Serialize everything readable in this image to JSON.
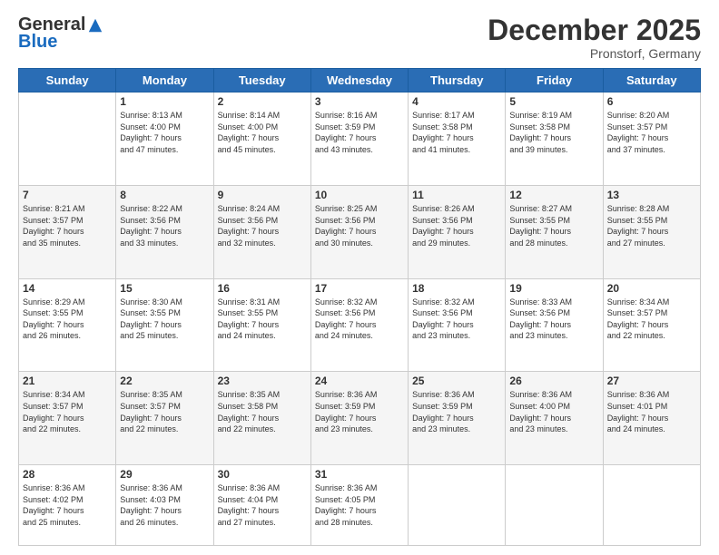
{
  "header": {
    "logo": {
      "general": "General",
      "blue": "Blue"
    },
    "title": "December 2025",
    "location": "Pronstorf, Germany"
  },
  "weekdays": [
    "Sunday",
    "Monday",
    "Tuesday",
    "Wednesday",
    "Thursday",
    "Friday",
    "Saturday"
  ],
  "weeks": [
    [
      {
        "day": "",
        "info": ""
      },
      {
        "day": "1",
        "info": "Sunrise: 8:13 AM\nSunset: 4:00 PM\nDaylight: 7 hours\nand 47 minutes."
      },
      {
        "day": "2",
        "info": "Sunrise: 8:14 AM\nSunset: 4:00 PM\nDaylight: 7 hours\nand 45 minutes."
      },
      {
        "day": "3",
        "info": "Sunrise: 8:16 AM\nSunset: 3:59 PM\nDaylight: 7 hours\nand 43 minutes."
      },
      {
        "day": "4",
        "info": "Sunrise: 8:17 AM\nSunset: 3:58 PM\nDaylight: 7 hours\nand 41 minutes."
      },
      {
        "day": "5",
        "info": "Sunrise: 8:19 AM\nSunset: 3:58 PM\nDaylight: 7 hours\nand 39 minutes."
      },
      {
        "day": "6",
        "info": "Sunrise: 8:20 AM\nSunset: 3:57 PM\nDaylight: 7 hours\nand 37 minutes."
      }
    ],
    [
      {
        "day": "7",
        "info": "Sunrise: 8:21 AM\nSunset: 3:57 PM\nDaylight: 7 hours\nand 35 minutes."
      },
      {
        "day": "8",
        "info": "Sunrise: 8:22 AM\nSunset: 3:56 PM\nDaylight: 7 hours\nand 33 minutes."
      },
      {
        "day": "9",
        "info": "Sunrise: 8:24 AM\nSunset: 3:56 PM\nDaylight: 7 hours\nand 32 minutes."
      },
      {
        "day": "10",
        "info": "Sunrise: 8:25 AM\nSunset: 3:56 PM\nDaylight: 7 hours\nand 30 minutes."
      },
      {
        "day": "11",
        "info": "Sunrise: 8:26 AM\nSunset: 3:56 PM\nDaylight: 7 hours\nand 29 minutes."
      },
      {
        "day": "12",
        "info": "Sunrise: 8:27 AM\nSunset: 3:55 PM\nDaylight: 7 hours\nand 28 minutes."
      },
      {
        "day": "13",
        "info": "Sunrise: 8:28 AM\nSunset: 3:55 PM\nDaylight: 7 hours\nand 27 minutes."
      }
    ],
    [
      {
        "day": "14",
        "info": "Sunrise: 8:29 AM\nSunset: 3:55 PM\nDaylight: 7 hours\nand 26 minutes."
      },
      {
        "day": "15",
        "info": "Sunrise: 8:30 AM\nSunset: 3:55 PM\nDaylight: 7 hours\nand 25 minutes."
      },
      {
        "day": "16",
        "info": "Sunrise: 8:31 AM\nSunset: 3:55 PM\nDaylight: 7 hours\nand 24 minutes."
      },
      {
        "day": "17",
        "info": "Sunrise: 8:32 AM\nSunset: 3:56 PM\nDaylight: 7 hours\nand 24 minutes."
      },
      {
        "day": "18",
        "info": "Sunrise: 8:32 AM\nSunset: 3:56 PM\nDaylight: 7 hours\nand 23 minutes."
      },
      {
        "day": "19",
        "info": "Sunrise: 8:33 AM\nSunset: 3:56 PM\nDaylight: 7 hours\nand 23 minutes."
      },
      {
        "day": "20",
        "info": "Sunrise: 8:34 AM\nSunset: 3:57 PM\nDaylight: 7 hours\nand 22 minutes."
      }
    ],
    [
      {
        "day": "21",
        "info": "Sunrise: 8:34 AM\nSunset: 3:57 PM\nDaylight: 7 hours\nand 22 minutes."
      },
      {
        "day": "22",
        "info": "Sunrise: 8:35 AM\nSunset: 3:57 PM\nDaylight: 7 hours\nand 22 minutes."
      },
      {
        "day": "23",
        "info": "Sunrise: 8:35 AM\nSunset: 3:58 PM\nDaylight: 7 hours\nand 22 minutes."
      },
      {
        "day": "24",
        "info": "Sunrise: 8:36 AM\nSunset: 3:59 PM\nDaylight: 7 hours\nand 23 minutes."
      },
      {
        "day": "25",
        "info": "Sunrise: 8:36 AM\nSunset: 3:59 PM\nDaylight: 7 hours\nand 23 minutes."
      },
      {
        "day": "26",
        "info": "Sunrise: 8:36 AM\nSunset: 4:00 PM\nDaylight: 7 hours\nand 23 minutes."
      },
      {
        "day": "27",
        "info": "Sunrise: 8:36 AM\nSunset: 4:01 PM\nDaylight: 7 hours\nand 24 minutes."
      }
    ],
    [
      {
        "day": "28",
        "info": "Sunrise: 8:36 AM\nSunset: 4:02 PM\nDaylight: 7 hours\nand 25 minutes."
      },
      {
        "day": "29",
        "info": "Sunrise: 8:36 AM\nSunset: 4:03 PM\nDaylight: 7 hours\nand 26 minutes."
      },
      {
        "day": "30",
        "info": "Sunrise: 8:36 AM\nSunset: 4:04 PM\nDaylight: 7 hours\nand 27 minutes."
      },
      {
        "day": "31",
        "info": "Sunrise: 8:36 AM\nSunset: 4:05 PM\nDaylight: 7 hours\nand 28 minutes."
      },
      {
        "day": "",
        "info": ""
      },
      {
        "day": "",
        "info": ""
      },
      {
        "day": "",
        "info": ""
      }
    ]
  ]
}
